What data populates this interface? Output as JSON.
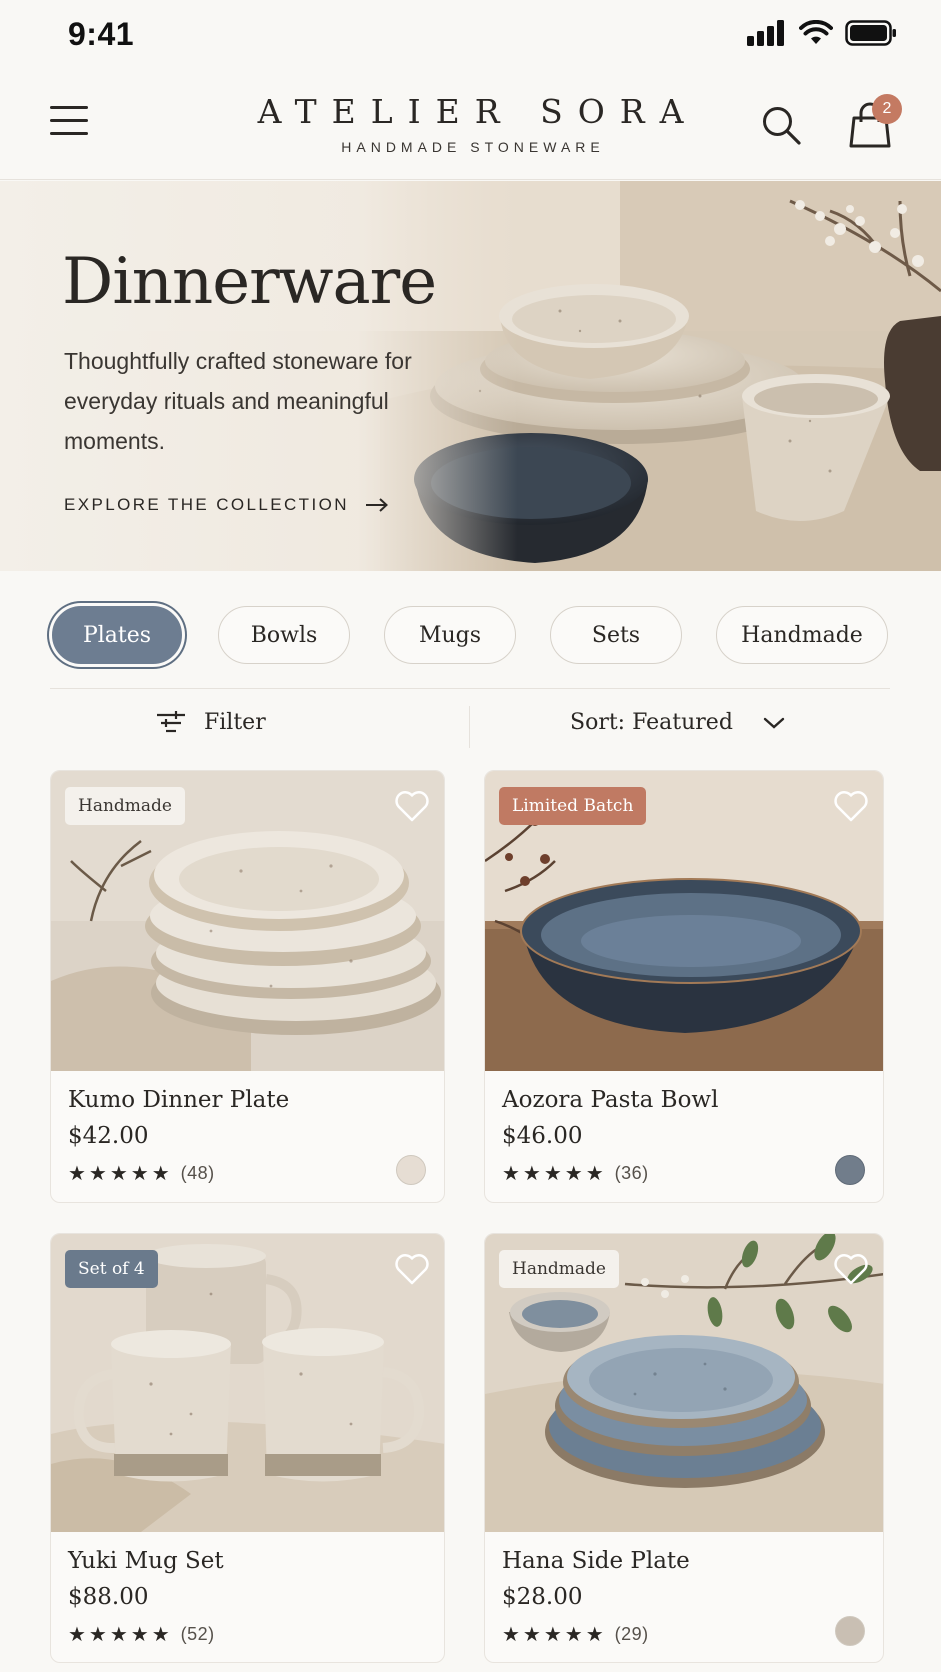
{
  "status_bar": {
    "time": "9:41"
  },
  "header": {
    "brand": "ATELIER SORA",
    "tagline": "HANDMADE STONEWARE",
    "cart_count": "2"
  },
  "hero": {
    "title": "Dinnerware",
    "description": "Thoughtfully crafted stoneware for everyday rituals and meaningful moments.",
    "cta": "EXPLORE THE COLLECTION"
  },
  "categories": [
    {
      "label": "Plates",
      "active": true
    },
    {
      "label": "Bowls",
      "active": false
    },
    {
      "label": "Mugs",
      "active": false
    },
    {
      "label": "Sets",
      "active": false
    },
    {
      "label": "Handmade",
      "active": false
    }
  ],
  "toolbar": {
    "filter_label": "Filter",
    "sort_label": "Sort: Featured"
  },
  "products": [
    {
      "badge": "Handmade",
      "name": "Kumo Dinner Plate",
      "price": "$42.00",
      "stars": "★★★★★",
      "reviews": "(48)",
      "swatch": "#e6ddd3"
    },
    {
      "badge": "Limited Batch",
      "name": "Aozora Pasta Bowl",
      "price": "$46.00",
      "stars": "★★★★★",
      "reviews": "(36)",
      "swatch": "#717d8b"
    },
    {
      "badge": "Set of 4",
      "name": "Yuki Mug Set",
      "price": "$88.00",
      "stars": "★★★★★",
      "reviews": "(52)",
      "swatch": ""
    },
    {
      "badge": "Handmade",
      "name": "Hana Side Plate",
      "price": "$28.00",
      "stars": "★★★★★",
      "reviews": "(29)",
      "swatch": "#c9bfb3"
    }
  ],
  "colors": {
    "accent_slate": "#6d7d91",
    "terracotta": "#c47a62",
    "background": "#f9f8f5"
  }
}
